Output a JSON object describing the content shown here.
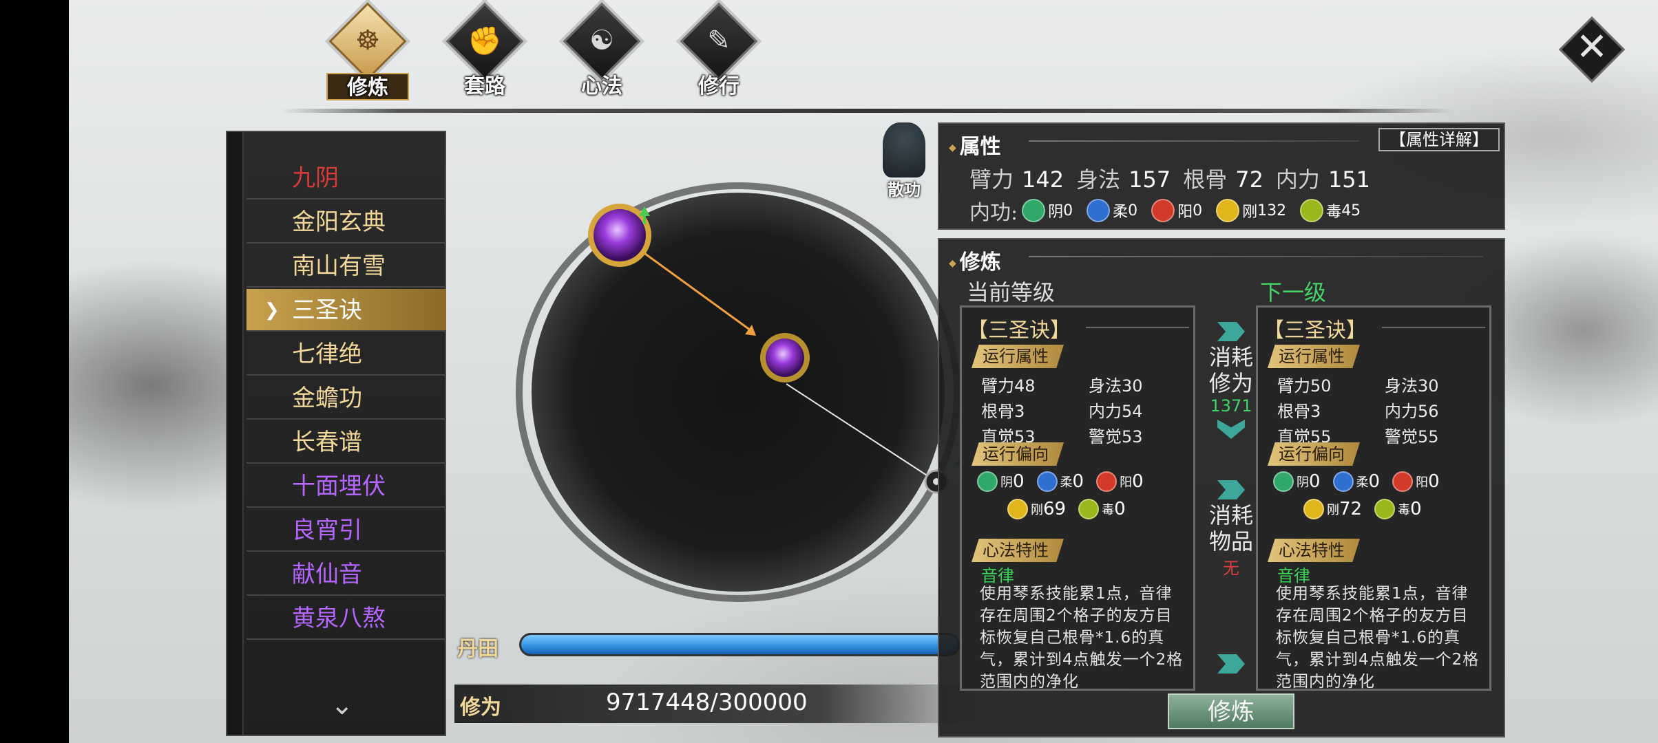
{
  "nav": {
    "tabs": [
      {
        "label": "修炼",
        "glyph": "☸"
      },
      {
        "label": "套路",
        "glyph": "✊"
      },
      {
        "label": "心法",
        "glyph": "☯"
      },
      {
        "label": "修行",
        "glyph": "✎"
      }
    ],
    "active_tab": "修炼",
    "close_glyph": "✕"
  },
  "techniques": {
    "items": [
      {
        "label": "九阴",
        "color": "#d83a3a"
      },
      {
        "label": "金阳玄典",
        "color": "#f0d79a"
      },
      {
        "label": "南山有雪",
        "color": "#f0d79a"
      },
      {
        "label": "三圣诀",
        "color": "#ffffff"
      },
      {
        "label": "七律绝",
        "color": "#f0d79a"
      },
      {
        "label": "金蟾功",
        "color": "#f0d79a"
      },
      {
        "label": "长春谱",
        "color": "#f0d79a"
      },
      {
        "label": "十面埋伏",
        "color": "#b466ff"
      },
      {
        "label": "良宵引",
        "color": "#b466ff"
      },
      {
        "label": "献仙音",
        "color": "#b466ff"
      },
      {
        "label": "黄泉八熬",
        "color": "#b466ff"
      }
    ],
    "selected": "三圣诀"
  },
  "center": {
    "scatter_label": "散功",
    "dantian_label": "丹田",
    "dantian_progress": 1.0,
    "xiuwei_label": "修为",
    "xiuwei_value": "9717448/300000"
  },
  "attributes": {
    "title": "属性",
    "detail_button": "【属性详解】",
    "stats": [
      {
        "name": "臂力",
        "value": "142"
      },
      {
        "name": "身法",
        "value": "157"
      },
      {
        "name": "根骨",
        "value": "72"
      },
      {
        "name": "内力",
        "value": "151"
      }
    ],
    "neigong_label": "内功:",
    "neigong": [
      {
        "name": "阴",
        "value": "0",
        "color": "#2fa86a"
      },
      {
        "name": "柔",
        "value": "0",
        "color": "#2f6fd0"
      },
      {
        "name": "阳",
        "value": "0",
        "color": "#d23a2a"
      },
      {
        "name": "刚",
        "value": "132",
        "color": "#e0b61c"
      },
      {
        "name": "毒",
        "value": "45",
        "color": "#9ab81c"
      }
    ]
  },
  "cultivation": {
    "title": "修炼",
    "current_header": "当前等级",
    "next_header": "下一级",
    "consume_cultivation": "消耗修为",
    "consume_amount": "1371",
    "consume_items": "消耗物品",
    "consume_items_value": "无",
    "button": "修炼",
    "current": {
      "name": "【三圣诀】",
      "run_attr_tag": "运行属性",
      "stats": [
        "臂力48",
        "身法30",
        "根骨3",
        "内力54",
        "直觉53",
        "警觉53"
      ],
      "bias_tag": "运行偏向",
      "bias": [
        {
          "name": "阴",
          "value": "0",
          "color": "#2fa86a"
        },
        {
          "name": "柔",
          "value": "0",
          "color": "#2f6fd0"
        },
        {
          "name": "阳",
          "value": "0",
          "color": "#d23a2a"
        },
        {
          "name": "刚",
          "value": "69",
          "color": "#e0b61c"
        },
        {
          "name": "毒",
          "value": "0",
          "color": "#9ab81c"
        }
      ],
      "trait_tag": "心法特性",
      "trait_name": "音律",
      "trait_desc": "使用琴系技能累1点，音律存在周围2个格子的友方目标恢复自己根骨*1.6的真气，累计到4点触发一个2格范围内的净化"
    },
    "next": {
      "name": "【三圣诀】",
      "run_attr_tag": "运行属性",
      "stats": [
        "臂力50",
        "身法30",
        "根骨3",
        "内力56",
        "直觉55",
        "警觉55"
      ],
      "bias_tag": "运行偏向",
      "bias": [
        {
          "name": "阴",
          "value": "0",
          "color": "#2fa86a"
        },
        {
          "name": "柔",
          "value": "0",
          "color": "#2f6fd0"
        },
        {
          "name": "阳",
          "value": "0",
          "color": "#d23a2a"
        },
        {
          "name": "刚",
          "value": "72",
          "color": "#e0b61c"
        },
        {
          "name": "毒",
          "value": "0",
          "color": "#9ab81c"
        }
      ],
      "trait_tag": "心法特性",
      "trait_name": "音律",
      "trait_desc": "使用琴系技能累1点，音律存在周围2个格子的友方目标恢复自己根骨*1.6的真气，累计到4点触发一个2格范围内的净化"
    }
  }
}
